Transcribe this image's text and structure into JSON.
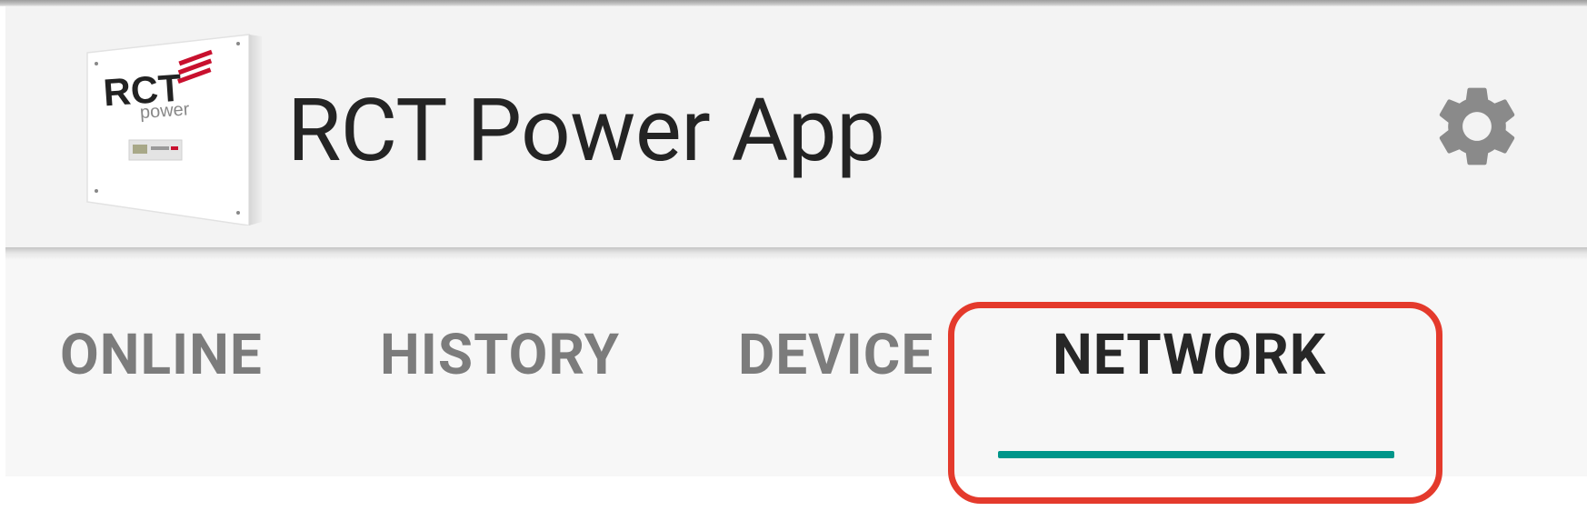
{
  "app": {
    "title": "RCT Power App",
    "logo": {
      "brand_text": "RCT",
      "sub_text": "power",
      "accent_color": "#c8102e"
    }
  },
  "toolbar": {
    "settings_icon": "gear-icon",
    "icon_color": "#8a8a8a"
  },
  "tabs": [
    {
      "label": "ONLINE",
      "active": false
    },
    {
      "label": "HISTORY",
      "active": false
    },
    {
      "label": "DEVICE",
      "active": false
    },
    {
      "label": "NETWORK",
      "active": true
    }
  ],
  "colors": {
    "toolbar_bg": "#f3f3f3",
    "tab_indicator": "#00968a",
    "highlight": "#e43a2c"
  }
}
